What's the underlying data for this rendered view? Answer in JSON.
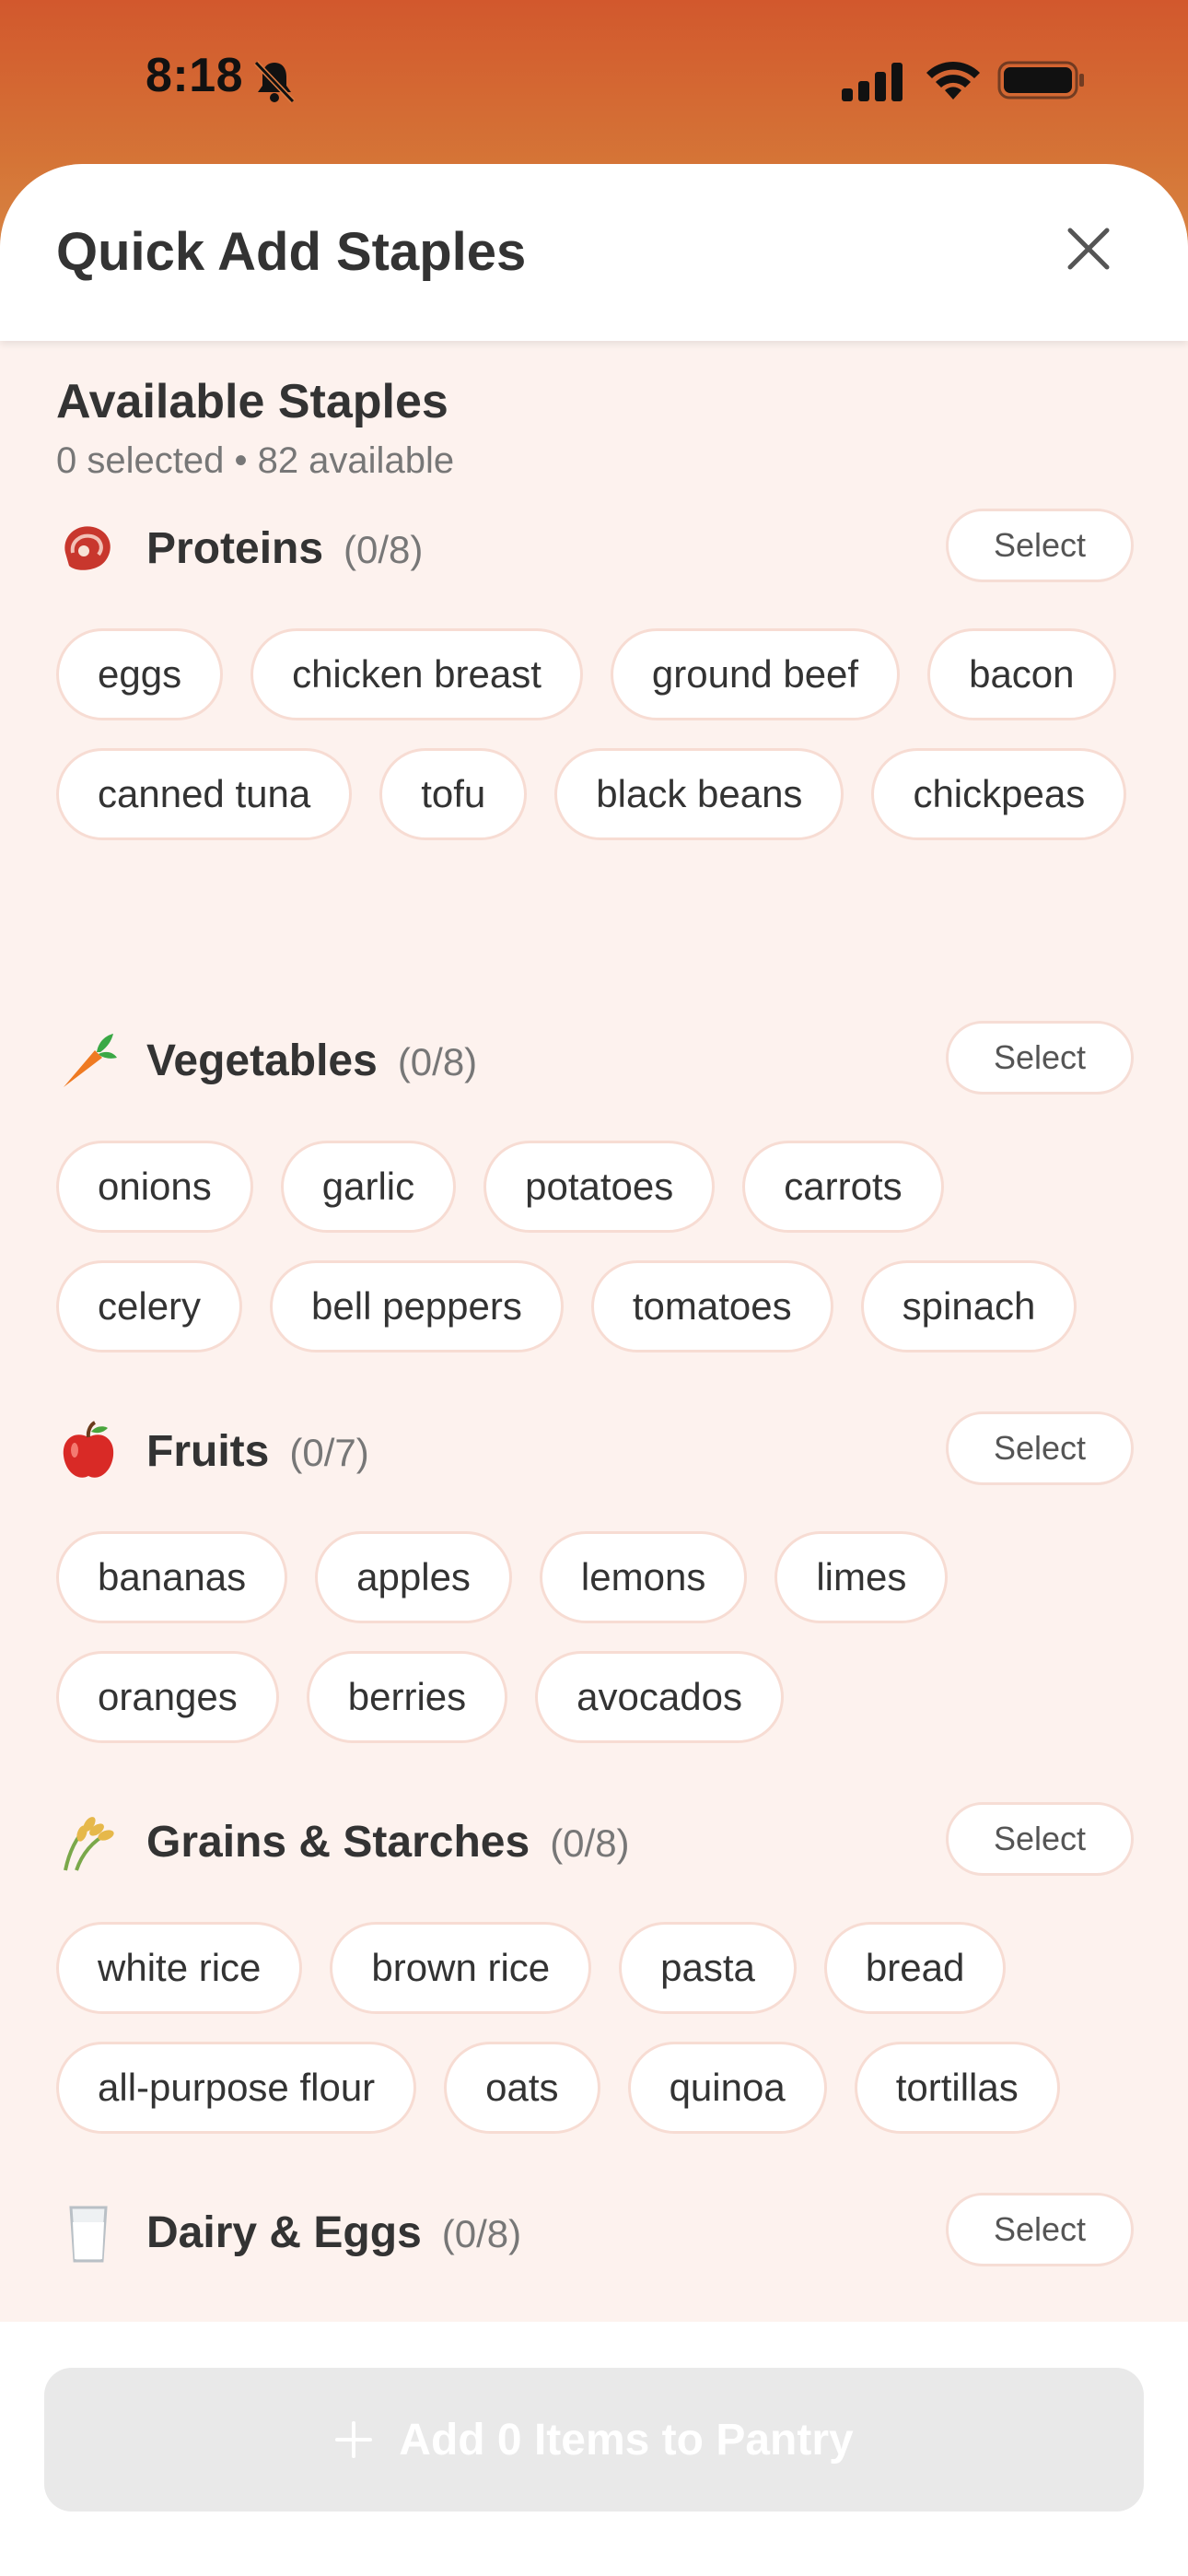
{
  "status_bar": {
    "time": "8:18"
  },
  "sheet": {
    "title": "Quick Add Staples",
    "available_title": "Available Staples",
    "available_sub": "0 selected • 82 available"
  },
  "select_label": "Select",
  "categories": [
    {
      "name": "Proteins",
      "count": "(0/8)",
      "icon": "meat-icon",
      "items": [
        "eggs",
        "chicken breast",
        "ground beef",
        "bacon",
        "canned tuna",
        "tofu",
        "black beans",
        "chickpeas"
      ]
    },
    {
      "name": "Vegetables",
      "count": "(0/8)",
      "icon": "carrot-icon",
      "items": [
        "onions",
        "garlic",
        "potatoes",
        "carrots",
        "celery",
        "bell peppers",
        "tomatoes",
        "spinach"
      ]
    },
    {
      "name": "Fruits",
      "count": "(0/7)",
      "icon": "apple-icon",
      "items": [
        "bananas",
        "apples",
        "lemons",
        "limes",
        "oranges",
        "berries",
        "avocados"
      ]
    },
    {
      "name": "Grains & Starches",
      "count": "(0/8)",
      "icon": "grain-icon",
      "items": [
        "white rice",
        "brown rice",
        "pasta",
        "bread",
        "all-purpose flour",
        "oats",
        "quinoa",
        "tortillas"
      ]
    },
    {
      "name": "Dairy & Eggs",
      "count": "(0/8)",
      "icon": "milk-icon",
      "items": []
    }
  ],
  "bottom": {
    "add_label": "Add 0 Items to Pantry"
  },
  "colors": {
    "accent": "#d2582d",
    "sheet_bg": "#fdf2ee",
    "chip_border": "#f7dcd3"
  }
}
